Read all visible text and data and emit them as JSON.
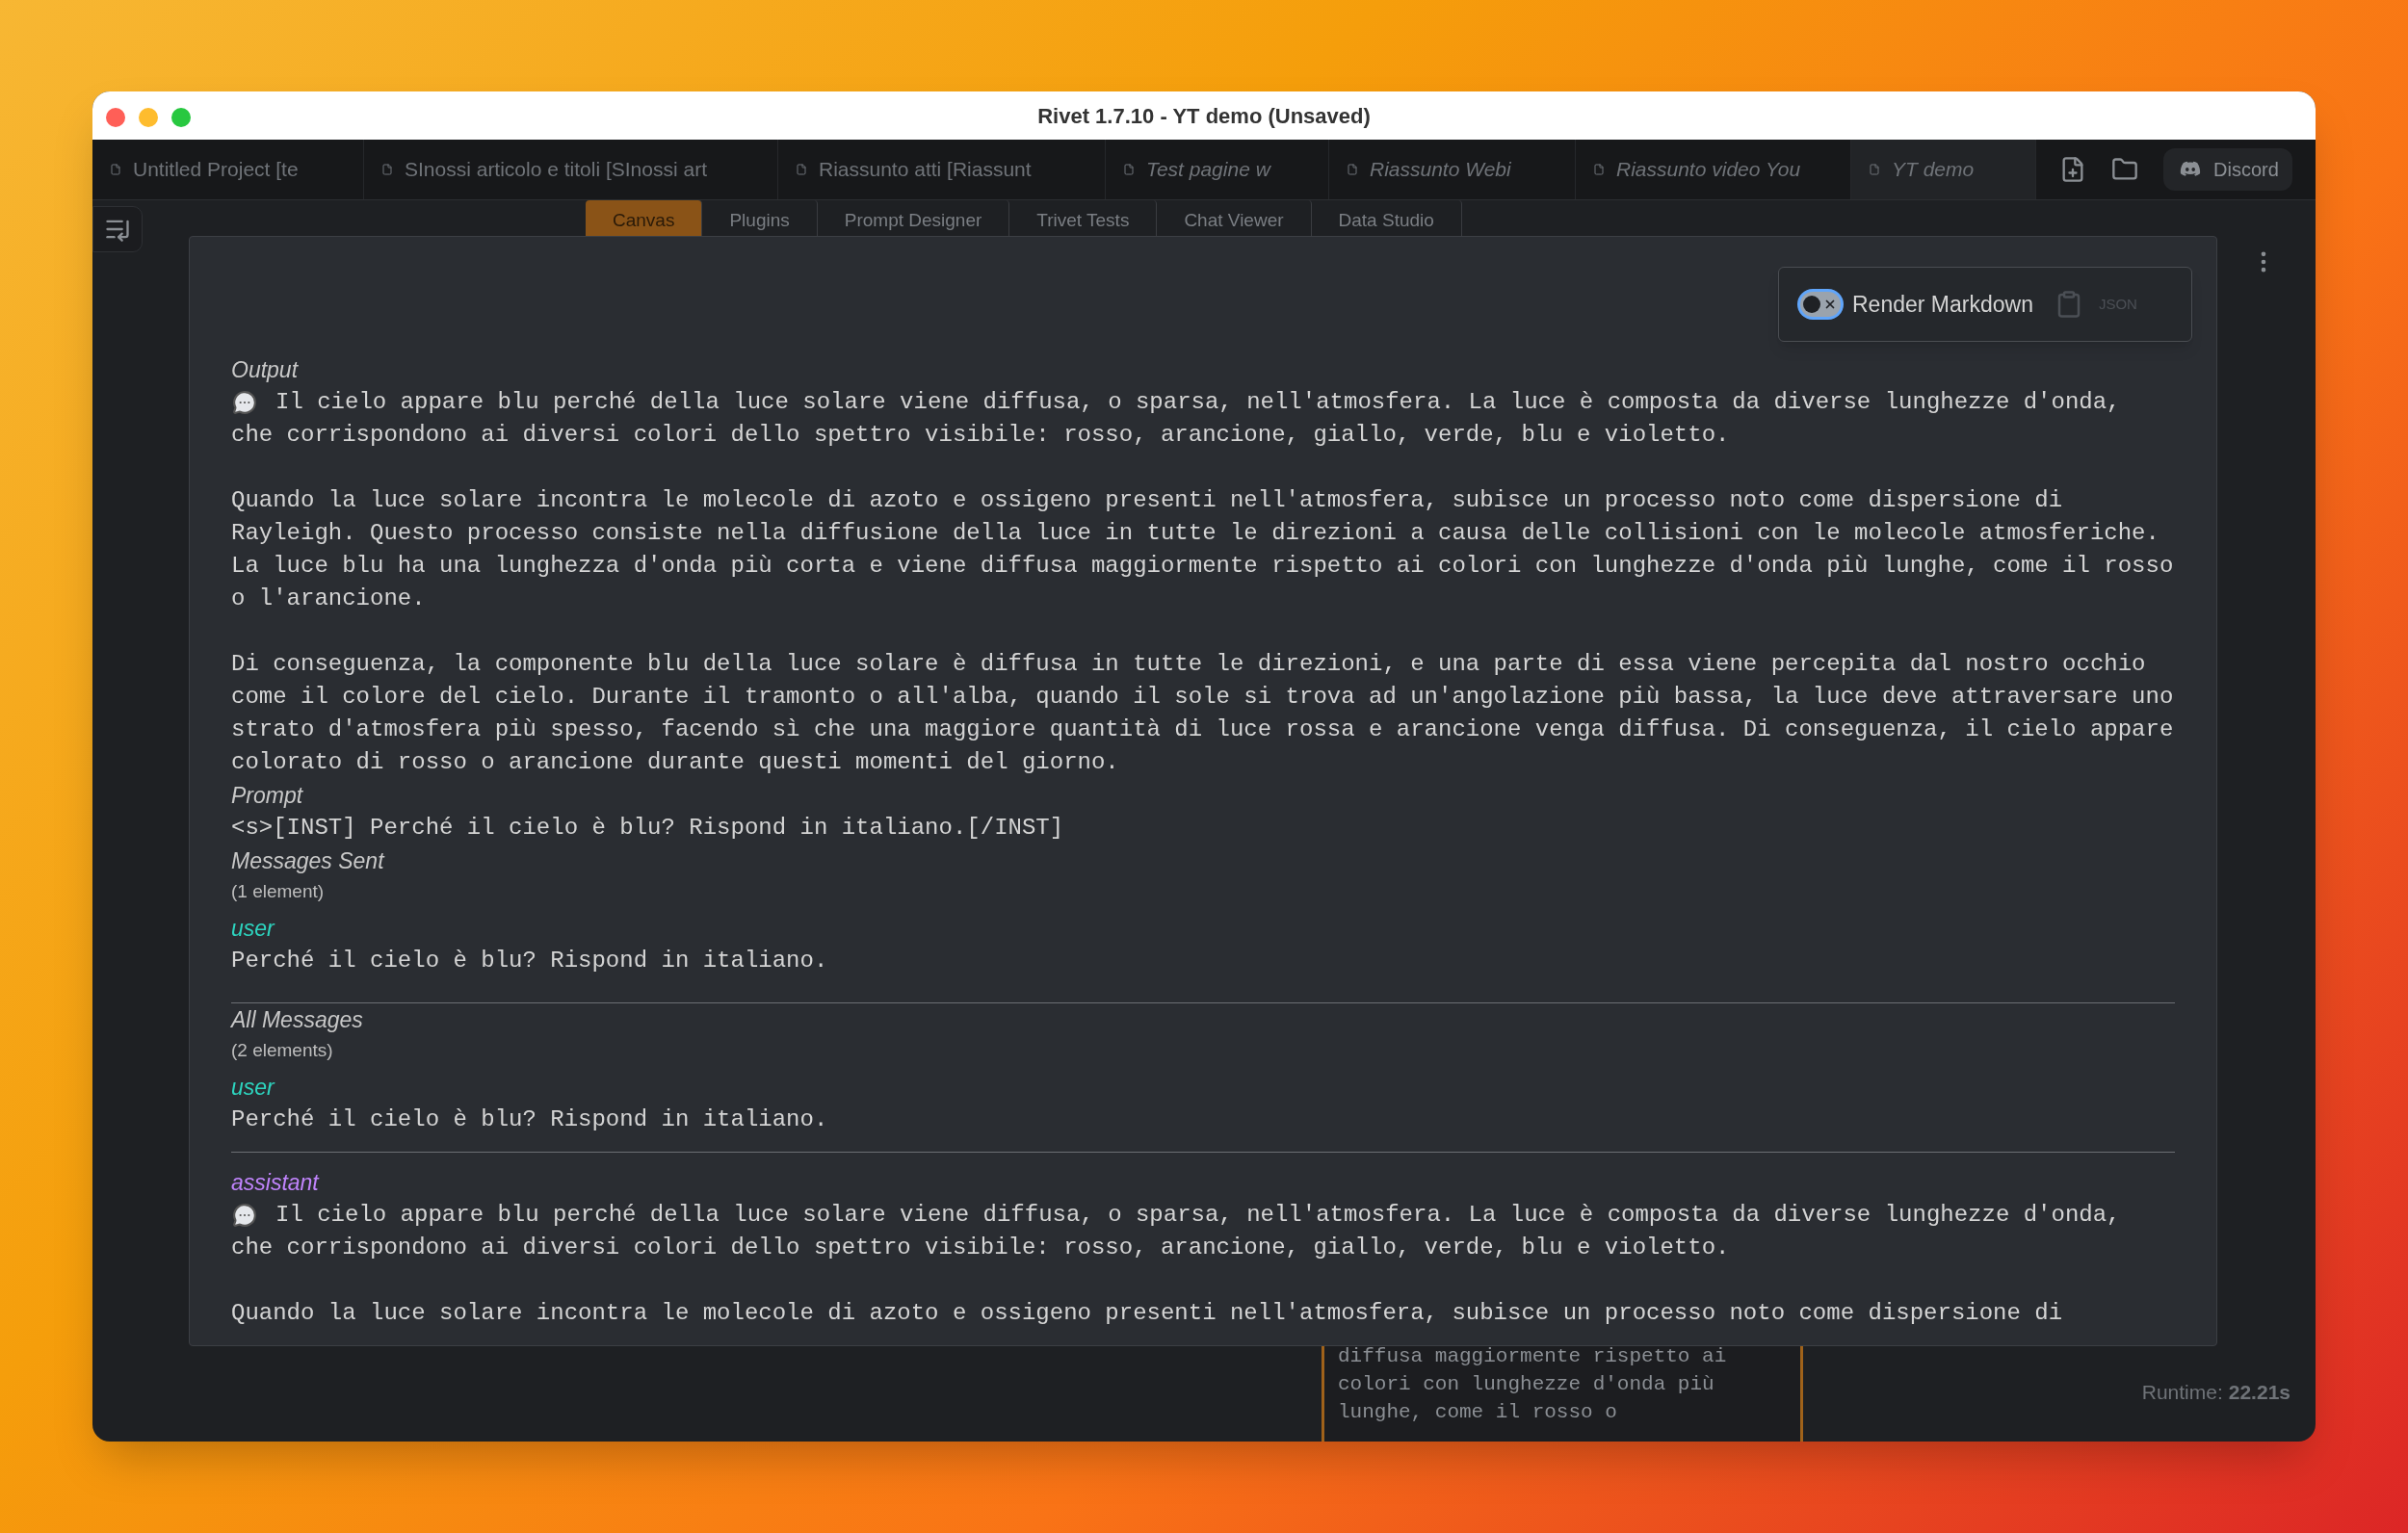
{
  "window": {
    "title": "Rivet 1.7.10 - YT demo (Unsaved)"
  },
  "project_tabs": [
    {
      "label": "Untitled Project [te",
      "italic": false,
      "selected": false
    },
    {
      "label": "SInossi articolo e titoli [SInossi art",
      "italic": false,
      "selected": false
    },
    {
      "label": "Riassunto atti [Riassunt",
      "italic": false,
      "selected": false
    },
    {
      "label": "Test pagine w",
      "italic": true,
      "selected": false
    },
    {
      "label": "Riassunto Webi",
      "italic": true,
      "selected": false
    },
    {
      "label": "Riassunto video You",
      "italic": true,
      "selected": false
    },
    {
      "label": "YT demo",
      "italic": true,
      "selected": true
    }
  ],
  "discord_button": {
    "label": "Discord"
  },
  "view_tabs": [
    {
      "label": "Canvas",
      "selected": true
    },
    {
      "label": "Plugins",
      "selected": false
    },
    {
      "label": "Prompt Designer",
      "selected": false
    },
    {
      "label": "Trivet Tests",
      "selected": false
    },
    {
      "label": "Chat Viewer",
      "selected": false
    },
    {
      "label": "Data Studio",
      "selected": false
    }
  ],
  "output_modal": {
    "toolbar": {
      "toggle": {
        "label": "Render Markdown",
        "on": false
      },
      "json_button": {
        "label": "JSON",
        "disabled": true
      }
    },
    "sections": [
      {
        "kind": "text",
        "label": "Output",
        "bubble_icon": true,
        "paragraphs": [
          "Il cielo appare blu perché della luce solare viene diffusa, o sparsa, nell'atmosfera. La luce è composta da diverse lunghezze d'onda, che corrispondono ai diversi colori dello spettro visibile: rosso, arancione, giallo, verde, blu e violetto.",
          "Quando la luce solare incontra le molecole di azoto e ossigeno presenti nell'atmosfera, subisce un processo noto come dispersione di Rayleigh. Questo processo consiste nella diffusione della luce in tutte le direzioni a causa delle collisioni con le molecole atmosferiche. La luce blu ha una lunghezza d'onda più corta e viene diffusa maggiormente rispetto ai colori con lunghezze d'onda più lunghe, come il rosso o l'arancione.",
          "Di conseguenza, la componente blu della luce solare è diffusa in tutte le direzioni, e una parte di essa viene percepita dal nostro occhio come il colore del cielo. Durante il tramonto o all'alba, quando il sole si trova ad un'angolazione più bassa, la luce deve attraversare uno strato d'atmosfera più spesso, facendo sì che una maggiore quantità di luce rossa e arancione venga diffusa. Di conseguenza, il cielo appare colorato di rosso o arancione durante questi momenti del giorno."
        ]
      },
      {
        "kind": "text",
        "label": "Prompt",
        "paragraphs": [
          "<s>[INST] Perché il cielo è blu? Rispond in italiano.[/INST]"
        ]
      },
      {
        "kind": "messages",
        "label": "Messages Sent",
        "count": "(1 element)",
        "messages": [
          {
            "role": "user",
            "color": "#2dd4bf",
            "paragraphs": [
              "Perché il cielo è blu? Rispond in italiano."
            ]
          }
        ]
      },
      {
        "kind": "messages",
        "label": "All Messages",
        "count": "(2 elements)",
        "messages": [
          {
            "role": "user",
            "color": "#2dd4bf",
            "paragraphs": [
              "Perché il cielo è blu? Rispond in italiano."
            ]
          },
          {
            "role": "assistant",
            "color": "#c084fc",
            "bubble_icon": true,
            "paragraphs": [
              "Il cielo appare blu perché della luce solare viene diffusa, o sparsa, nell'atmosfera. La luce è composta da diverse lunghezze d'onda, che corrispondono ai diversi colori dello spettro visibile: rosso, arancione, giallo, verde, blu e violetto.",
              "Quando la luce solare incontra le molecole di azoto e ossigeno presenti nell'atmosfera, subisce un processo noto come dispersione di"
            ]
          }
        ]
      }
    ]
  },
  "node_preview": {
    "lines": [
      "diffusa maggiormente rispetto ai",
      "colori con lunghezze d'onda più",
      "lunghe, come il rosso o"
    ]
  },
  "runtime": {
    "label": "Runtime:",
    "value": "22.21s"
  }
}
